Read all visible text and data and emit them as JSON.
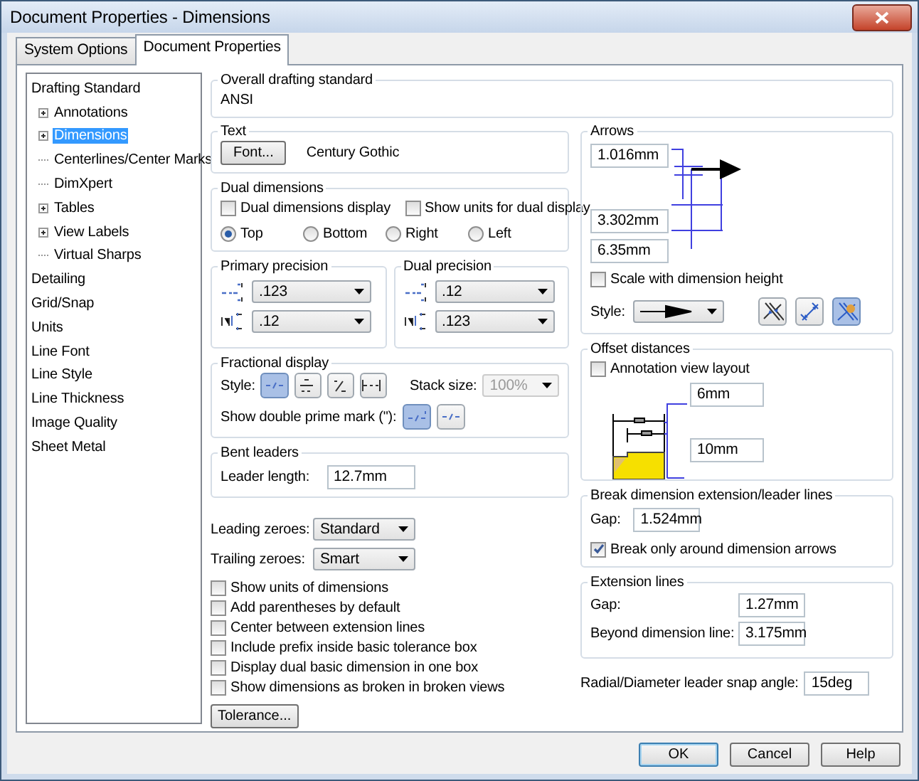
{
  "window": {
    "title": "Document Properties - Dimensions"
  },
  "tabs": [
    {
      "label": "System Options",
      "selected": false
    },
    {
      "label": "Document Properties",
      "selected": true
    }
  ],
  "tree": [
    {
      "label": "Drafting Standard",
      "selected": false,
      "children": [
        {
          "label": "Annotations",
          "selected": false,
          "expandable": true
        },
        {
          "label": "Dimensions",
          "selected": true,
          "expandable": true
        },
        {
          "label": "Centerlines/Center Marks",
          "selected": false,
          "expandable": false
        },
        {
          "label": "DimXpert",
          "selected": false,
          "expandable": false
        },
        {
          "label": "Tables",
          "selected": false,
          "expandable": true
        },
        {
          "label": "View Labels",
          "selected": false,
          "expandable": true
        },
        {
          "label": "Virtual Sharps",
          "selected": false,
          "expandable": false
        }
      ]
    },
    {
      "label": "Detailing",
      "selected": false
    },
    {
      "label": "Grid/Snap",
      "selected": false
    },
    {
      "label": "Units",
      "selected": false
    },
    {
      "label": "Line Font",
      "selected": false
    },
    {
      "label": "Line Style",
      "selected": false
    },
    {
      "label": "Line Thickness",
      "selected": false
    },
    {
      "label": "Image Quality",
      "selected": false
    },
    {
      "label": "Sheet Metal",
      "selected": false
    }
  ],
  "overall_standard": {
    "label": "Overall drafting standard",
    "value": "ANSI"
  },
  "text_group": {
    "label": "Text",
    "button": "Font...",
    "font_name": "Century Gothic"
  },
  "dual_dimensions": {
    "label": "Dual dimensions",
    "checkboxes": [
      {
        "label": "Dual dimensions display",
        "checked": false
      },
      {
        "label": "Show units for dual display",
        "checked": false
      }
    ],
    "positions": [
      {
        "label": "Top",
        "selected": true
      },
      {
        "label": "Bottom",
        "selected": false
      },
      {
        "label": "Right",
        "selected": false
      },
      {
        "label": "Left",
        "selected": false
      }
    ]
  },
  "precision": [
    {
      "label": "Primary precision",
      "rows": [
        {
          "kind": "value",
          "value": ".123"
        },
        {
          "kind": "tolerance",
          "value": ".12"
        }
      ]
    },
    {
      "label": "Dual precision",
      "rows": [
        {
          "kind": "value",
          "value": ".12"
        },
        {
          "kind": "tolerance",
          "value": ".123"
        }
      ]
    }
  ],
  "fractional_display": {
    "label": "Fractional display",
    "style_label": "Style:",
    "styles": [
      {
        "kind": "inline",
        "selected": true
      },
      {
        "kind": "stacked",
        "selected": false
      },
      {
        "kind": "diagonal",
        "selected": false
      },
      {
        "kind": "decimal",
        "selected": false
      }
    ],
    "stack_label": "Stack size:",
    "stack_size": {
      "value": "100%",
      "disabled": true
    },
    "prime_label": "Show double prime mark (\"):",
    "prime_styles": [
      {
        "kind": "prime",
        "selected": true
      },
      {
        "kind": "inline",
        "selected": false
      }
    ]
  },
  "bent_leaders": {
    "label": "Bent leaders",
    "length_label": "Leader length:",
    "length": "12.7mm"
  },
  "zeroes": [
    {
      "label": "Leading zeroes:",
      "value": "Standard"
    },
    {
      "label": "Trailing zeroes:",
      "value": "Smart"
    }
  ],
  "options": [
    {
      "label": "Show units of dimensions",
      "checked": false
    },
    {
      "label": "Add parentheses by default",
      "checked": false
    },
    {
      "label": "Center between extension lines",
      "checked": false
    },
    {
      "label": "Include prefix inside basic tolerance box",
      "checked": false
    },
    {
      "label": "Display dual basic dimension in one box",
      "checked": false
    },
    {
      "label": "Show dimensions as broken in broken views",
      "checked": false
    }
  ],
  "tolerance_button": "Tolerance...",
  "arrows": {
    "label": "Arrows",
    "sizes": [
      "1.016mm",
      "3.302mm",
      "6.35mm"
    ],
    "scale": {
      "label": "Scale with dimension height",
      "checked": false
    },
    "style_label": "Style:",
    "placements": [
      {
        "kind": "outside",
        "selected": false
      },
      {
        "kind": "inside",
        "selected": false
      },
      {
        "kind": "smart",
        "selected": true
      }
    ]
  },
  "offset_distances": {
    "label": "Offset distances",
    "layout": {
      "label": "Annotation view layout",
      "checked": false
    },
    "distances": [
      "6mm",
      "10mm"
    ]
  },
  "break_lines": {
    "label": "Break dimension extension/leader lines",
    "gap_label": "Gap:",
    "gap": "1.524mm",
    "around_arrows": {
      "label": "Break only around dimension arrows",
      "checked": true
    }
  },
  "extension_lines": {
    "label": "Extension lines",
    "rows": [
      {
        "label": "Gap:",
        "value": "1.27mm"
      },
      {
        "label": "Beyond dimension line:",
        "value": "3.175mm"
      }
    ]
  },
  "snap_angle": {
    "label": "Radial/Diameter leader snap angle:",
    "value": "15deg"
  },
  "buttons": [
    {
      "label": "OK",
      "default": true
    },
    {
      "label": "Cancel",
      "default": false
    },
    {
      "label": "Help",
      "default": false
    }
  ]
}
